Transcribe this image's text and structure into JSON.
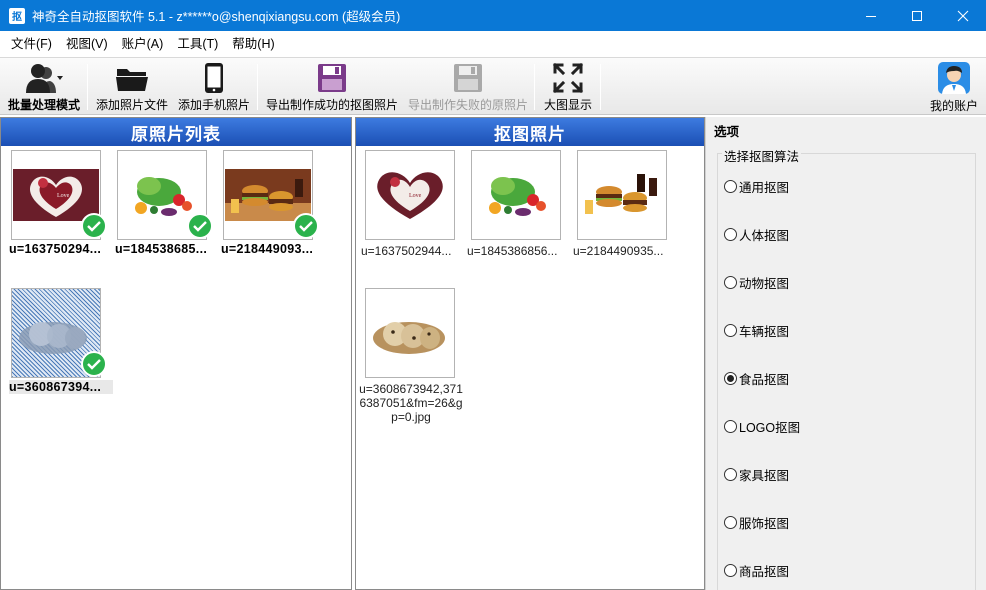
{
  "window": {
    "title": "神奇全自动抠图软件 5.1 - z******o@shenqixiangsu.com (超级会员)",
    "app_icon_text": "抠"
  },
  "menu": [
    "文件(F)",
    "视图(V)",
    "账户(A)",
    "工具(T)",
    "帮助(H)"
  ],
  "toolbar": {
    "batch_mode": "批量处理模式",
    "add_files": "添加照片文件",
    "add_phone": "添加手机照片",
    "export_success": "导出制作成功的抠图照片",
    "export_failed": "导出制作失败的原照片",
    "large_view": "大图显示",
    "my_account": "我的账户"
  },
  "left_panel": {
    "title": "原照片列表",
    "items": [
      {
        "name": "u=163750294...",
        "image": "heart-cake",
        "done": true
      },
      {
        "name": "u=184538685...",
        "image": "vegetables",
        "done": true
      },
      {
        "name": "u=218449093...",
        "image": "burgers",
        "done": true
      },
      {
        "name": "u=360867394...",
        "image": "bread",
        "done": true
      }
    ]
  },
  "middle_panel": {
    "title": "抠图照片",
    "items": [
      {
        "name": "u=1637502944...",
        "image": "heart-cake"
      },
      {
        "name": "u=1845386856...",
        "image": "vegetables"
      },
      {
        "name": "u=2184490935...",
        "image": "burgers"
      },
      {
        "name": "u=3608673942,3716387051&fm=26&gp=0.jpg",
        "image": "bread"
      }
    ]
  },
  "options": {
    "title": "选项",
    "group_title": "选择抠图算法",
    "radios": [
      {
        "label": "通用抠图",
        "checked": false
      },
      {
        "label": "人体抠图",
        "checked": false
      },
      {
        "label": "动物抠图",
        "checked": false
      },
      {
        "label": "车辆抠图",
        "checked": false
      },
      {
        "label": "食品抠图",
        "checked": true
      },
      {
        "label": "LOGO抠图",
        "checked": false
      },
      {
        "label": "家具抠图",
        "checked": false
      },
      {
        "label": "服饰抠图",
        "checked": false
      },
      {
        "label": "商品抠图",
        "checked": false
      }
    ]
  },
  "colors": {
    "titlebar": "#0a78d6",
    "panel_header": "#1b4fb4",
    "check_green": "#2bb24c",
    "save_purple": "#7b3b8a"
  }
}
